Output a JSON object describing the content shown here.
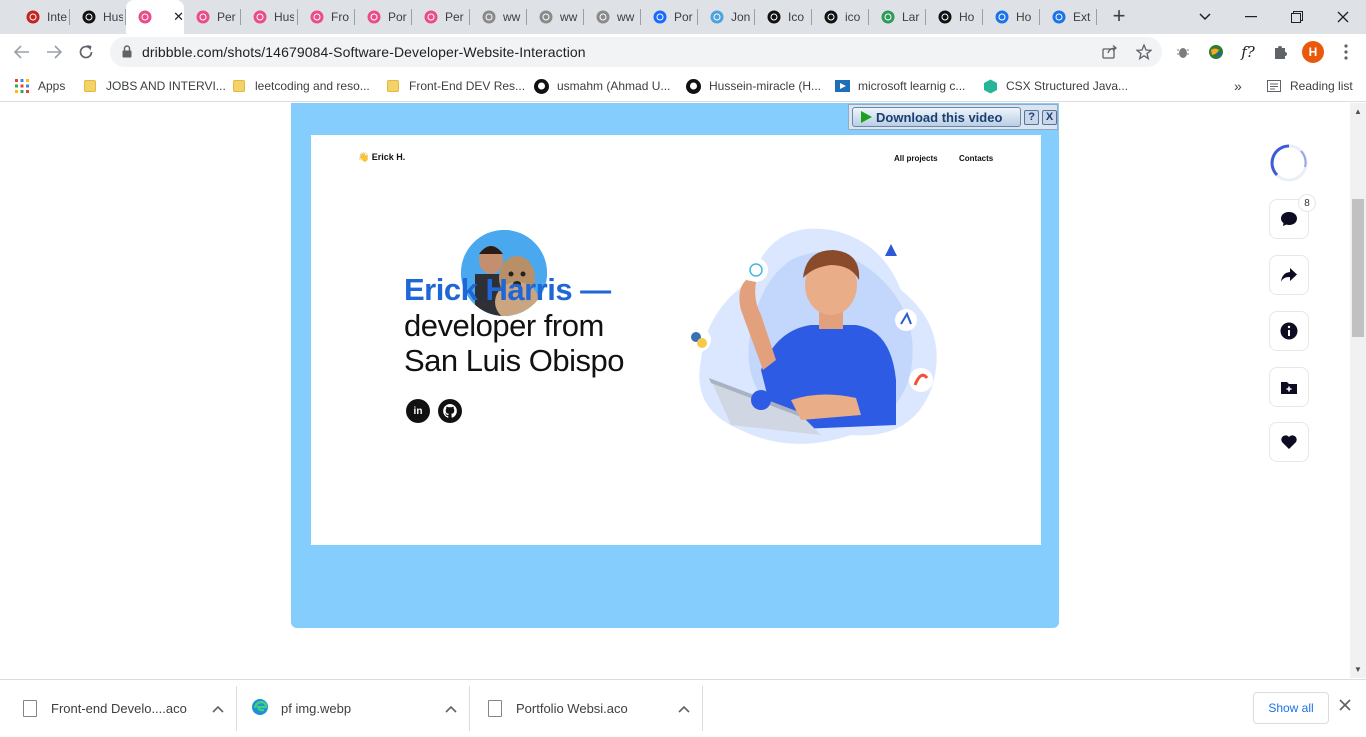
{
  "tabs": [
    {
      "title": "Inte",
      "icon": "speedometer-icon",
      "color": "#c5221f"
    },
    {
      "title": "Hus",
      "icon": "github-icon",
      "color": "#111111"
    },
    {
      "title": "",
      "icon": "dribbble-icon",
      "color": "#ea4c89",
      "active": true
    },
    {
      "title": "Per",
      "icon": "dribbble-icon",
      "color": "#ea4c89"
    },
    {
      "title": "Hus",
      "icon": "dribbble-icon",
      "color": "#ea4c89"
    },
    {
      "title": "Fro",
      "icon": "dribbble-icon",
      "color": "#ea4c89"
    },
    {
      "title": "Por",
      "icon": "dribbble-icon",
      "color": "#ea4c89"
    },
    {
      "title": "Per",
      "icon": "dribbble-icon",
      "color": "#ea4c89"
    },
    {
      "title": "ww",
      "icon": "behance-grey-icon",
      "color": "#8a8a8a"
    },
    {
      "title": "ww",
      "icon": "behance-grey-icon",
      "color": "#8a8a8a"
    },
    {
      "title": "ww",
      "icon": "behance-grey-icon",
      "color": "#8a8a8a"
    },
    {
      "title": "Por",
      "icon": "behance-icon",
      "color": "#1769ff"
    },
    {
      "title": "Jon",
      "icon": "diamond-icon",
      "color": "#4aa3df"
    },
    {
      "title": "Ico",
      "icon": "circle-logo-icon",
      "color": "#111111"
    },
    {
      "title": "ico",
      "icon": "grid-logo-icon",
      "color": "#111111"
    },
    {
      "title": "Lar",
      "icon": "leaf-icon",
      "color": "#2e9a5a"
    },
    {
      "title": "Ho",
      "icon": "code-bracket-icon",
      "color": "#111111"
    },
    {
      "title": "Ho",
      "icon": "loading-icon",
      "color": "#1a73e8"
    },
    {
      "title": "Ext",
      "icon": "puzzle-icon",
      "color": "#1a73e8"
    }
  ],
  "toolbar": {
    "url": "dribbble.com/shots/14679084-Software-Developer-Website-Interaction",
    "profile_initial": "H"
  },
  "bookmarks": {
    "apps": "Apps",
    "items": [
      {
        "label": "JOBS AND INTERVI...",
        "icon": "folder-icon"
      },
      {
        "label": "leetcoding and reso...",
        "icon": "folder-icon"
      },
      {
        "label": "Front-End DEV Res...",
        "icon": "folder-icon"
      },
      {
        "label": "usmahm (Ahmad U...",
        "icon": "github-icon"
      },
      {
        "label": "Hussein-miracle (H...",
        "icon": "github-icon"
      },
      {
        "label": "microsoft learnig c...",
        "icon": "video-icon"
      },
      {
        "label": "CSX Structured Java...",
        "icon": "csx-icon"
      }
    ],
    "more": "»",
    "reading_list": "Reading list"
  },
  "shot": {
    "brand": "👋 Erick H.",
    "nav": [
      "All projects",
      "Contacts"
    ],
    "hero_name": "Erick Harris —",
    "hero_line2": "developer from",
    "hero_line3": "San Luis Obispo",
    "social": [
      "in",
      "gh"
    ]
  },
  "download_bar": {
    "button": "Download this video",
    "help": "?",
    "close": "X"
  },
  "sidebar": {
    "comment_count": "8"
  },
  "downloads": [
    {
      "name": "Front-end Develo....aco",
      "icon": "file-icon"
    },
    {
      "name": "pf img.webp",
      "icon": "edge-icon"
    },
    {
      "name": "Portfolio Websi.aco",
      "icon": "file-icon"
    }
  ],
  "shelf": {
    "show_all": "Show all"
  }
}
